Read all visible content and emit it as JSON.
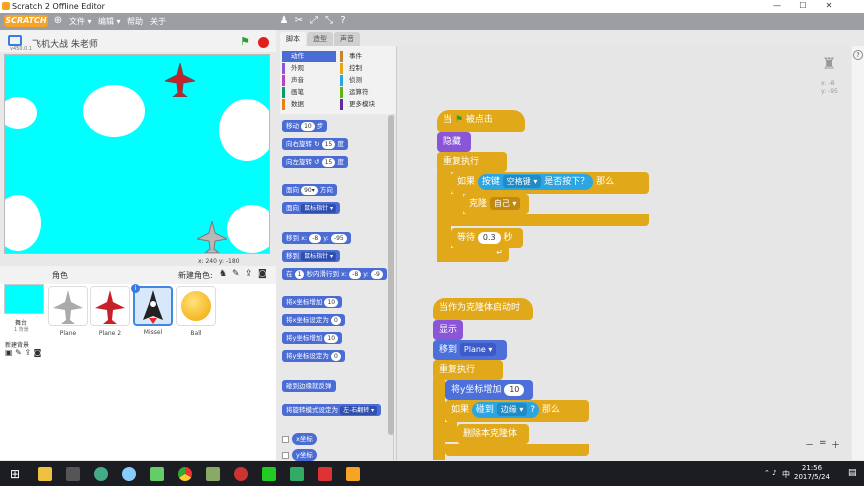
{
  "window": {
    "title": "Scratch 2 Offline Editor",
    "min": "—",
    "max": "☐",
    "close": "✕"
  },
  "menubar": {
    "logo": "SCRATCH",
    "items": [
      "文件 ▾",
      "编辑 ▾",
      "帮助",
      "关于"
    ]
  },
  "stage": {
    "project_title": "飞机大战 朱老师",
    "version": "v450.0.1",
    "coords": "x: 240  y: -180"
  },
  "sprites": {
    "header": "角色",
    "new_sprite": "新建角色:",
    "stage_label": "舞台",
    "stage_bg_count": "1 背景",
    "new_bg": "新建背景",
    "items": [
      {
        "name": "Plane"
      },
      {
        "name": "Plane 2"
      },
      {
        "name": "Missel"
      },
      {
        "name": "Ball"
      }
    ]
  },
  "tabs": [
    "脚本",
    "造型",
    "声音"
  ],
  "categories": [
    {
      "label": "动作",
      "color": "#4a6cd4"
    },
    {
      "label": "事件",
      "color": "#c88330"
    },
    {
      "label": "外观",
      "color": "#8a55d7"
    },
    {
      "label": "控制",
      "color": "#e1a91a"
    },
    {
      "label": "声音",
      "color": "#bb42c3"
    },
    {
      "label": "侦测",
      "color": "#2ca5e2"
    },
    {
      "label": "画笔",
      "color": "#0e9a6c"
    },
    {
      "label": "运算符",
      "color": "#5cb712"
    },
    {
      "label": "数据",
      "color": "#ee7d16"
    },
    {
      "label": "更多模块",
      "color": "#632d99"
    }
  ],
  "palette": {
    "move": "移动",
    "move_val": "10",
    "move_unit": "步",
    "turn_r": "向右旋转",
    "turn_r_val": "15",
    "deg": "度",
    "turn_l": "向左旋转",
    "turn_l_val": "15",
    "point_dir": "面向",
    "point_dir_val": "90▾",
    "point_dir_unit": "方向",
    "point_to": "面向",
    "point_to_val": "鼠标指针 ▾",
    "goto_xy": "移到 x:",
    "goto_x": "-8",
    "goto_y_lbl": "y:",
    "goto_y": "-95",
    "goto": "移到",
    "goto_val": "鼠标指针 ▾",
    "glide": "在",
    "glide_sec": "1",
    "glide_mid": "秒内滑行到 x:",
    "glide_x": "-8",
    "glide_y_lbl": "y:",
    "glide_y": "-9",
    "chg_x": "将x坐标增加",
    "chg_x_val": "10",
    "set_x": "将x坐标设定为",
    "set_x_val": "0",
    "chg_y": "将y坐标增加",
    "chg_y_val": "10",
    "set_y": "将y坐标设定为",
    "set_y_val": "0",
    "bounce": "碰到边缘就反弹",
    "rot_style": "将旋转模式设定为",
    "rot_style_val": "左-右翻转 ▾",
    "x_pos": "x坐标",
    "y_pos": "y坐标"
  },
  "script1": {
    "when": "当",
    "flag_clicked": "被点击",
    "hide": "隐藏",
    "forever": "重复执行",
    "if": "如果",
    "key": "按键",
    "space": "空格键 ▾",
    "pressed": "是否按下？",
    "then": "那么",
    "clone": "克隆",
    "myself": "自己 ▾",
    "wait": "等待",
    "wait_val": "0.3",
    "sec": "秒"
  },
  "script2": {
    "clone_start": "当作为克隆体启动时",
    "show": "显示",
    "goto": "移到",
    "plane": "Plane ▾",
    "forever": "重复执行",
    "chg_y": "将y坐标增加",
    "chg_y_val": "10",
    "if": "如果",
    "touching": "碰到",
    "edge": "边缘 ▾",
    "q": "?",
    "then": "那么",
    "delete": "删除本克隆体"
  },
  "sprite_info": {
    "x": "x: -8",
    "y": "y: -95"
  },
  "zoom": {
    "out": "－",
    "reset": "=",
    "in": "＋"
  },
  "taskbar": {
    "time": "21:56",
    "date": "2017/5/24",
    "ime": "中"
  }
}
